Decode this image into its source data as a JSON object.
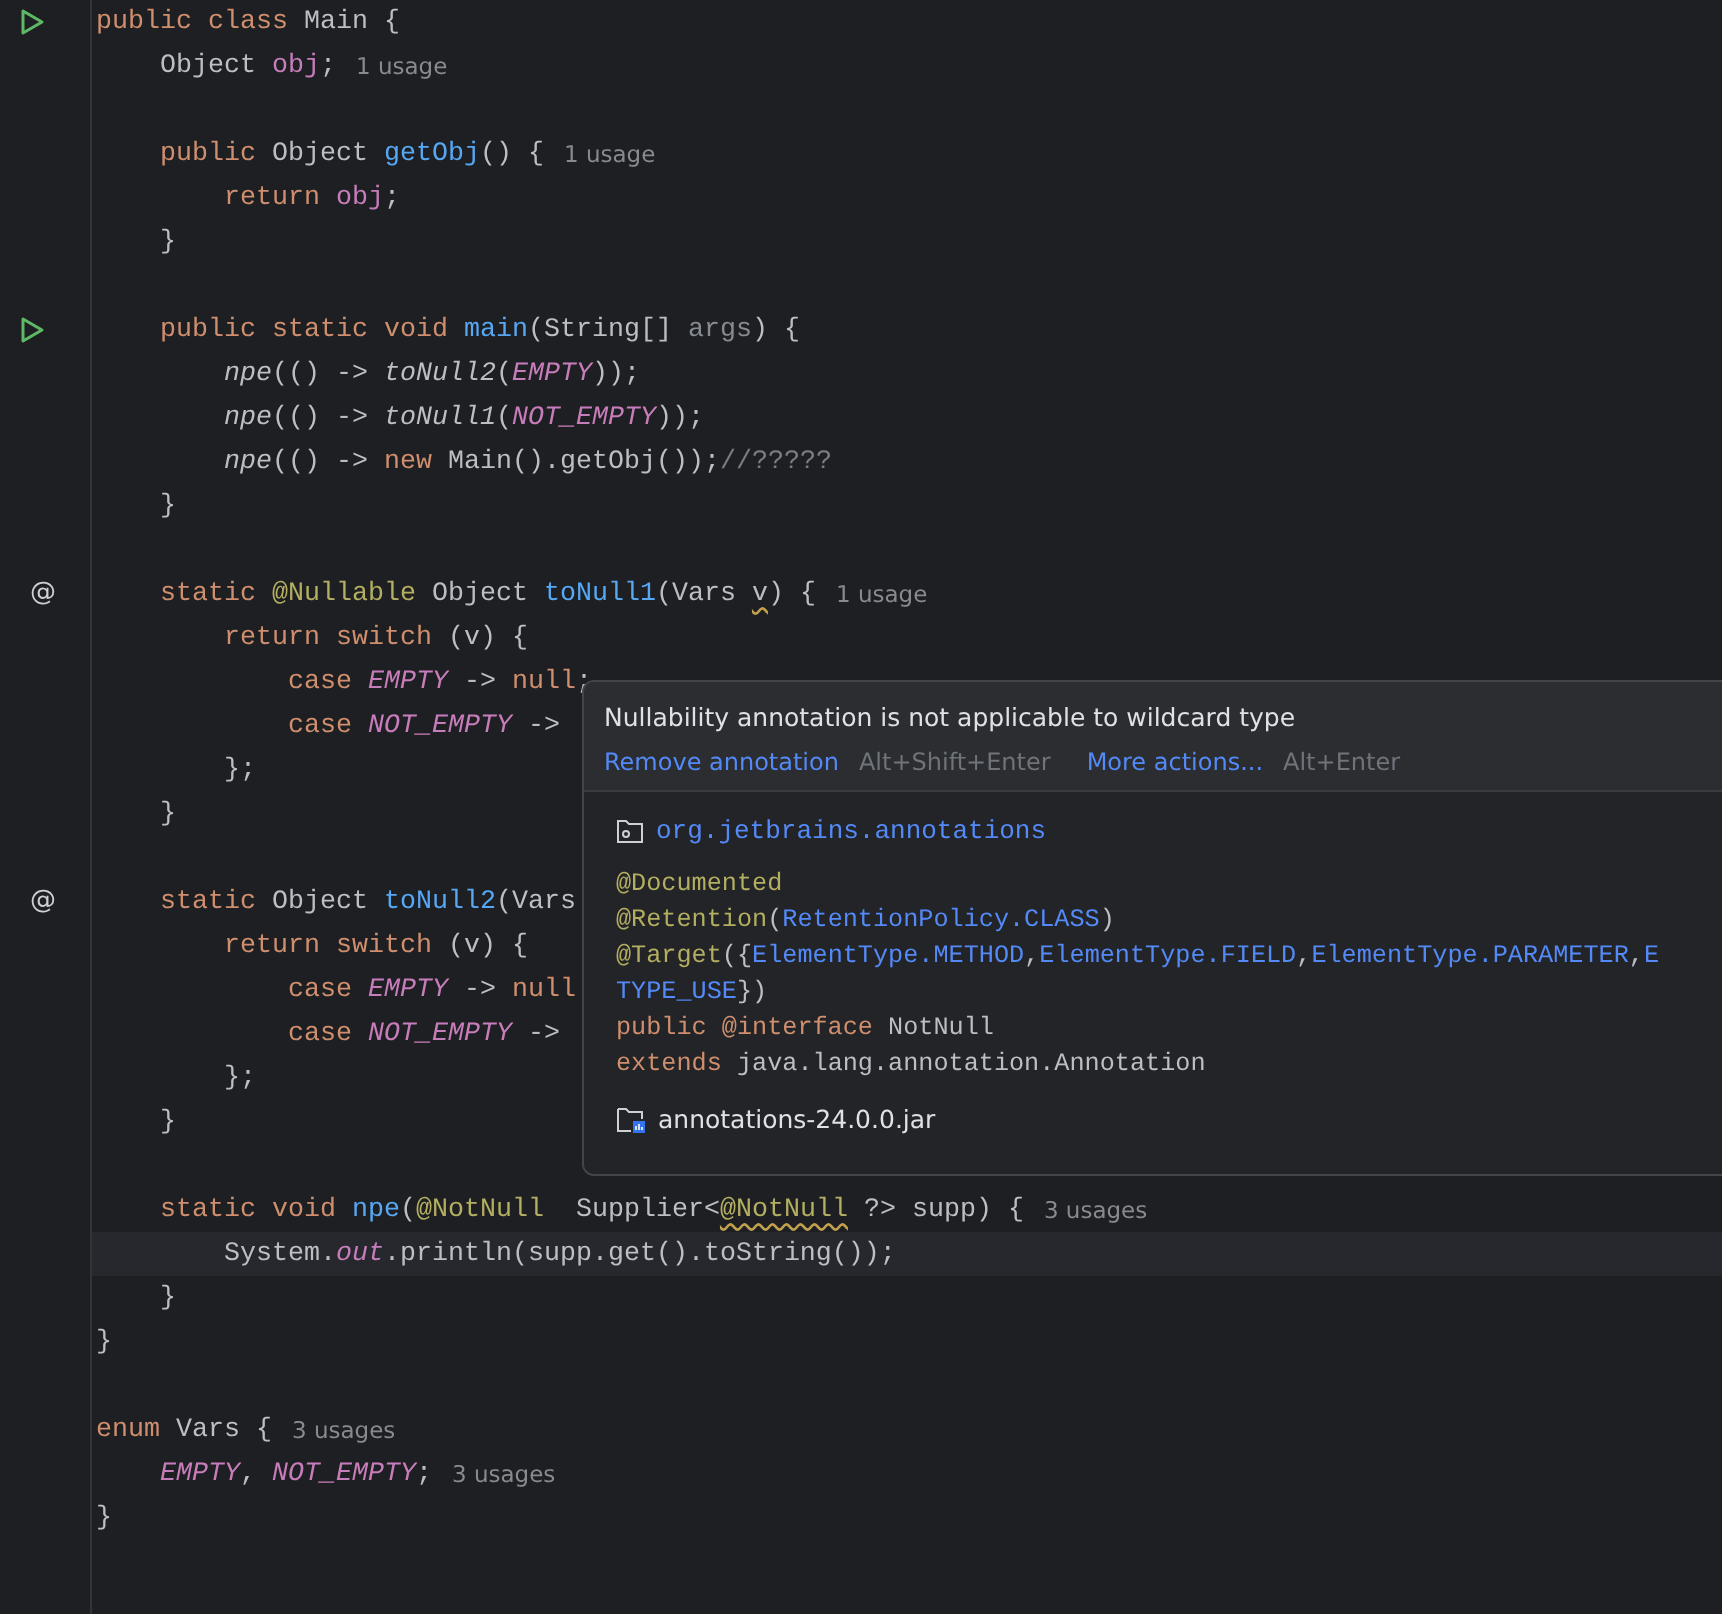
{
  "code_lines": [
    {
      "kind": "code",
      "gutter": {
        "kind": "run"
      },
      "tokens": [
        {
          "t": "public class ",
          "kind": "kw"
        },
        {
          "t": "Main {",
          "kind": "pl"
        }
      ]
    },
    {
      "kind": "code",
      "tokens": [
        {
          "t": "    Object ",
          "kind": "pl"
        },
        {
          "t": "obj",
          "kind": "fld"
        },
        {
          "t": ";",
          "kind": "pl"
        },
        {
          "t": "1 usage",
          "kind": "hint"
        }
      ]
    },
    {
      "kind": "blank"
    },
    {
      "kind": "code",
      "tokens": [
        {
          "t": "    public ",
          "kind": "kw"
        },
        {
          "t": "Object ",
          "kind": "pl"
        },
        {
          "t": "getObj",
          "kind": "fn"
        },
        {
          "t": "() {",
          "kind": "pl"
        },
        {
          "t": "1 usage",
          "kind": "hint"
        }
      ]
    },
    {
      "kind": "code",
      "tokens": [
        {
          "t": "        return ",
          "kind": "kw"
        },
        {
          "t": "obj",
          "kind": "fld"
        },
        {
          "t": ";",
          "kind": "pl"
        }
      ]
    },
    {
      "kind": "code",
      "tokens": [
        {
          "t": "    }",
          "kind": "pl"
        }
      ]
    },
    {
      "kind": "blank"
    },
    {
      "kind": "code",
      "gutter": {
        "kind": "run"
      },
      "tokens": [
        {
          "t": "    public static void ",
          "kind": "kw"
        },
        {
          "t": "main",
          "kind": "fn"
        },
        {
          "t": "(String[] ",
          "kind": "pl"
        },
        {
          "t": "args",
          "kind": "par"
        },
        {
          "t": ") {",
          "kind": "pl"
        }
      ]
    },
    {
      "kind": "code",
      "tokens": [
        {
          "t": "        npe",
          "kind": "sfn"
        },
        {
          "t": "(() -> ",
          "kind": "pl"
        },
        {
          "t": "toNull2",
          "kind": "sfn"
        },
        {
          "t": "(",
          "kind": "pl"
        },
        {
          "t": "EMPTY",
          "kind": "cst"
        },
        {
          "t": "));",
          "kind": "pl"
        }
      ]
    },
    {
      "kind": "code",
      "tokens": [
        {
          "t": "        npe",
          "kind": "sfn"
        },
        {
          "t": "(() -> ",
          "kind": "pl"
        },
        {
          "t": "toNull1",
          "kind": "sfn"
        },
        {
          "t": "(",
          "kind": "pl"
        },
        {
          "t": "NOT_EMPTY",
          "kind": "cst"
        },
        {
          "t": "));",
          "kind": "pl"
        }
      ]
    },
    {
      "kind": "code",
      "tokens": [
        {
          "t": "        npe",
          "kind": "sfn"
        },
        {
          "t": "(() -> ",
          "kind": "pl"
        },
        {
          "t": "new ",
          "kind": "kw"
        },
        {
          "t": "Main().getObj());",
          "kind": "pl"
        },
        {
          "t": "//?????",
          "kind": "cmt"
        }
      ]
    },
    {
      "kind": "code",
      "tokens": [
        {
          "t": "    }",
          "kind": "pl"
        }
      ]
    },
    {
      "kind": "blank"
    },
    {
      "kind": "code",
      "gutter": {
        "kind": "at",
        "text": "@"
      },
      "tokens": [
        {
          "t": "    static ",
          "kind": "kw"
        },
        {
          "t": "@Nullable",
          "kind": "ann"
        },
        {
          "t": " Object ",
          "kind": "pl"
        },
        {
          "t": "toNull1",
          "kind": "fn"
        },
        {
          "t": "(Vars ",
          "kind": "pl"
        },
        {
          "t": "v",
          "kind": "pl",
          "warn": true
        },
        {
          "t": ") {",
          "kind": "pl"
        },
        {
          "t": "1 usage",
          "kind": "hint"
        }
      ]
    },
    {
      "kind": "code",
      "tokens": [
        {
          "t": "        return switch ",
          "kind": "kw"
        },
        {
          "t": "(v) {",
          "kind": "pl"
        }
      ]
    },
    {
      "kind": "code",
      "tokens": [
        {
          "t": "            case ",
          "kind": "kw"
        },
        {
          "t": "EMPTY",
          "kind": "cst"
        },
        {
          "t": " -> ",
          "kind": "pl"
        },
        {
          "t": "null",
          "kind": "kw"
        },
        {
          "t": ";",
          "kind": "pl"
        }
      ]
    },
    {
      "kind": "code",
      "tokens": [
        {
          "t": "            case ",
          "kind": "kw"
        },
        {
          "t": "NOT_EMPTY",
          "kind": "cst"
        },
        {
          "t": " ->",
          "kind": "pl"
        }
      ]
    },
    {
      "kind": "code",
      "tokens": [
        {
          "t": "        };",
          "kind": "pl"
        }
      ]
    },
    {
      "kind": "code",
      "tokens": [
        {
          "t": "    }",
          "kind": "pl"
        }
      ]
    },
    {
      "kind": "blank"
    },
    {
      "kind": "code",
      "gutter": {
        "kind": "at",
        "text": "@"
      },
      "tokens": [
        {
          "t": "    static ",
          "kind": "kw"
        },
        {
          "t": "Object ",
          "kind": "pl"
        },
        {
          "t": "toNull2",
          "kind": "fn"
        },
        {
          "t": "(Vars",
          "kind": "pl"
        }
      ]
    },
    {
      "kind": "code",
      "tokens": [
        {
          "t": "        return switch ",
          "kind": "kw"
        },
        {
          "t": "(v) {",
          "kind": "pl"
        }
      ]
    },
    {
      "kind": "code",
      "tokens": [
        {
          "t": "            case ",
          "kind": "kw"
        },
        {
          "t": "EMPTY",
          "kind": "cst"
        },
        {
          "t": " -> ",
          "kind": "pl"
        },
        {
          "t": "null",
          "kind": "kw"
        }
      ]
    },
    {
      "kind": "code",
      "tokens": [
        {
          "t": "            case ",
          "kind": "kw"
        },
        {
          "t": "NOT_EMPTY",
          "kind": "cst"
        },
        {
          "t": " ->",
          "kind": "pl"
        }
      ]
    },
    {
      "kind": "code",
      "tokens": [
        {
          "t": "        };",
          "kind": "pl"
        }
      ]
    },
    {
      "kind": "code",
      "tokens": [
        {
          "t": "    }",
          "kind": "pl"
        }
      ]
    },
    {
      "kind": "blank"
    },
    {
      "kind": "code",
      "tokens": [
        {
          "t": "    static void ",
          "kind": "kw"
        },
        {
          "t": "npe",
          "kind": "fn"
        },
        {
          "t": "(",
          "kind": "pl"
        },
        {
          "t": "@NotNull",
          "kind": "ann"
        },
        {
          "t": "  Supplier<",
          "kind": "pl"
        },
        {
          "t": "@NotNull",
          "kind": "ann",
          "warn": true
        },
        {
          "t": " ?> supp) {",
          "kind": "pl"
        },
        {
          "t": "3 usages",
          "kind": "hint"
        }
      ]
    },
    {
      "kind": "code",
      "current": true,
      "tokens": [
        {
          "t": "        System.",
          "kind": "pl"
        },
        {
          "t": "out",
          "kind": "cst"
        },
        {
          "t": ".println(supp.get().toString());",
          "kind": "pl"
        }
      ]
    },
    {
      "kind": "code",
      "tokens": [
        {
          "t": "    }",
          "kind": "pl"
        }
      ]
    },
    {
      "kind": "code",
      "tokens": [
        {
          "t": "}",
          "kind": "pl"
        }
      ]
    },
    {
      "kind": "blank"
    },
    {
      "kind": "code",
      "tokens": [
        {
          "t": "enum ",
          "kind": "kw"
        },
        {
          "t": "Vars {",
          "kind": "pl"
        },
        {
          "t": "3 usages",
          "kind": "hint"
        }
      ]
    },
    {
      "kind": "code",
      "tokens": [
        {
          "t": "    EMPTY",
          "kind": "cst"
        },
        {
          "t": ", ",
          "kind": "pl"
        },
        {
          "t": "NOT_EMPTY",
          "kind": "cst"
        },
        {
          "t": ";",
          "kind": "pl"
        },
        {
          "t": "3 usages",
          "kind": "hint"
        }
      ]
    },
    {
      "kind": "code",
      "tokens": [
        {
          "t": "}",
          "kind": "pl"
        }
      ]
    }
  ],
  "popup": {
    "message": "Nullability annotation is not applicable to wildcard type",
    "actions": [
      {
        "label": "Remove annotation",
        "shortcut": "Alt+Shift+Enter"
      },
      {
        "label": "More actions...",
        "shortcut": "Alt+Enter"
      }
    ],
    "package": "org.jetbrains.annotations",
    "doc_lines": [
      [
        {
          "t": "@Documented",
          "kind": "ann"
        }
      ],
      [
        {
          "t": "@Retention",
          "kind": "ann"
        },
        {
          "t": "(",
          "kind": "pl"
        },
        {
          "t": "RetentionPolicy.CLASS",
          "kind": "link"
        },
        {
          "t": ")",
          "kind": "pl"
        }
      ],
      [
        {
          "t": "@Target",
          "kind": "ann"
        },
        {
          "t": "({",
          "kind": "pl"
        },
        {
          "t": "ElementType.METHOD",
          "kind": "link"
        },
        {
          "t": ",",
          "kind": "pl"
        },
        {
          "t": "ElementType.FIELD",
          "kind": "link"
        },
        {
          "t": ",",
          "kind": "pl"
        },
        {
          "t": "ElementType.PARAMETER",
          "kind": "link"
        },
        {
          "t": ",",
          "kind": "pl"
        },
        {
          "t": "E",
          "kind": "link"
        }
      ],
      [
        {
          "t": "TYPE_USE",
          "kind": "link"
        },
        {
          "t": "})",
          "kind": "pl"
        }
      ],
      [
        {
          "t": "public ",
          "kind": "kw"
        },
        {
          "t": "@interface ",
          "kind": "kw"
        },
        {
          "t": "NotNull",
          "kind": "pl"
        }
      ],
      [
        {
          "t": "extends ",
          "kind": "kw"
        },
        {
          "t": "java.lang.annotation.Annotation",
          "kind": "pl"
        }
      ]
    ],
    "library": "annotations-24.0.0.jar"
  }
}
